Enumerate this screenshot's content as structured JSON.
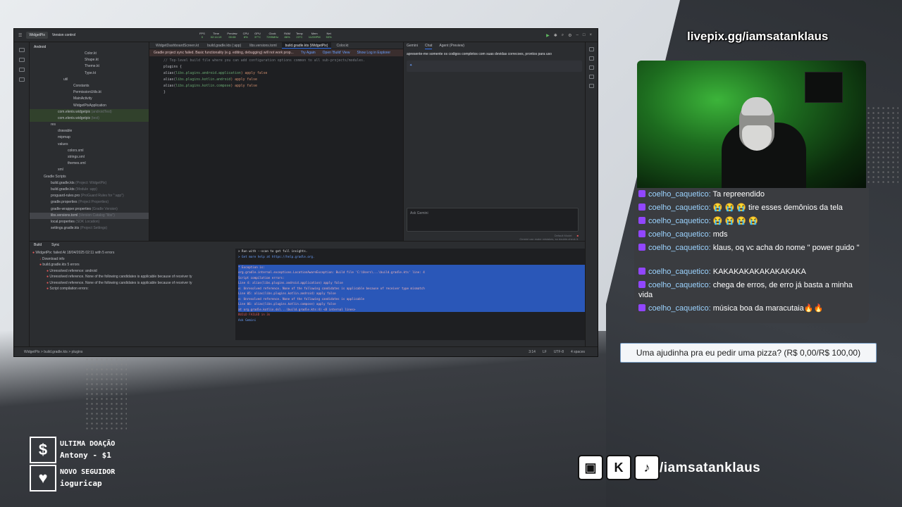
{
  "overlay": {
    "livepix": "livepix.gg/iamsatanklaus",
    "handle": "/iamsatanklaus",
    "pizza_goal": "Uma ajudinha pra eu pedir uma pizza? (R$ 0,00/R$ 100,00)",
    "last_donation_label": "ULTIMA DOAÇÃO",
    "last_donation_value": "Antony - $1",
    "new_follower_label": "NOVO SEGUIDOR",
    "new_follower_value": "ioguricap",
    "social_icons": [
      "twitch-icon",
      "kick-icon",
      "tiktok-icon"
    ]
  },
  "chat": [
    {
      "user": "coelho_caquetico",
      "text": "Ta repreendido"
    },
    {
      "user": "coelho_caquetico",
      "text": "😭 😭 😭 tire esses demônios da tela"
    },
    {
      "user": "coelho_caquetico",
      "text": "😭 😭 😭 😭"
    },
    {
      "user": "coelho_caquetico",
      "text": "mds"
    },
    {
      "user": "coelho_caquetico",
      "text": "klaus, oq vc acha do nome \" power guido \""
    },
    {
      "user": "coelho_caquetico",
      "text": "KAKAKAKAKAKAKAKAKA"
    },
    {
      "user": "coelho_caquetico",
      "text": "chega de erros, de erro já basta a minha vida"
    },
    {
      "user": "coelho_caquetico",
      "text": "música boa da maracutaia🔥🔥"
    }
  ],
  "ide": {
    "project": "WidgetPix",
    "version_control": "Version control",
    "stats": [
      {
        "label": "FPS",
        "value": "0"
      },
      {
        "label": "Time",
        "value": "02:14:19"
      },
      {
        "label": "Preview",
        "value": "00:08"
      },
      {
        "label": "CPU",
        "value": "8%"
      },
      {
        "label": "GPU",
        "value": "37°C"
      },
      {
        "label": "Clock",
        "value": "7295MHz"
      },
      {
        "label": "RAM",
        "value": "86%"
      },
      {
        "label": "Temp",
        "value": "23°C"
      },
      {
        "label": "Mem",
        "value": "11239PM"
      },
      {
        "label": "Net",
        "value": "53%"
      }
    ],
    "tree_header": "Android",
    "tree": [
      {
        "label": "Color.kt",
        "meta": "",
        "indent": 78,
        "cls": ""
      },
      {
        "label": "Shape.kt",
        "meta": "",
        "indent": 78,
        "cls": ""
      },
      {
        "label": "Theme.kt",
        "meta": "",
        "indent": 78,
        "cls": ""
      },
      {
        "label": "Type.kt",
        "meta": "",
        "indent": 78,
        "cls": ""
      },
      {
        "label": "util",
        "meta": "",
        "indent": 48,
        "cls": ""
      },
      {
        "label": "Constants",
        "meta": "",
        "indent": 62,
        "cls": ""
      },
      {
        "label": "PermissionUtils.kt",
        "meta": "",
        "indent": 62,
        "cls": ""
      },
      {
        "label": "MainActivity",
        "meta": "",
        "indent": 62,
        "cls": ""
      },
      {
        "label": "WidgetPixApplication",
        "meta": "",
        "indent": 62,
        "cls": ""
      },
      {
        "label": "com.elenis.widgetpix",
        "meta": "(androidTest)",
        "indent": 40,
        "cls": "hl"
      },
      {
        "label": "com.elenis.widgetpix",
        "meta": "(test)",
        "indent": 40,
        "cls": "hl"
      },
      {
        "label": "res",
        "meta": "",
        "indent": 30,
        "cls": ""
      },
      {
        "label": "drawable",
        "meta": "",
        "indent": 40,
        "cls": ""
      },
      {
        "label": "mipmap",
        "meta": "",
        "indent": 40,
        "cls": ""
      },
      {
        "label": "values",
        "meta": "",
        "indent": 40,
        "cls": ""
      },
      {
        "label": "colors.xml",
        "meta": "",
        "indent": 54,
        "cls": ""
      },
      {
        "label": "strings.xml",
        "meta": "",
        "indent": 54,
        "cls": ""
      },
      {
        "label": "themes.xml",
        "meta": "",
        "indent": 54,
        "cls": ""
      },
      {
        "label": "xml",
        "meta": "",
        "indent": 40,
        "cls": ""
      },
      {
        "label": "Gradle Scripts",
        "meta": "",
        "indent": 20,
        "cls": ""
      },
      {
        "label": "build.gradle.kts",
        "meta": "(Project: WidgetPix)",
        "indent": 30,
        "cls": ""
      },
      {
        "label": "build.gradle.kts",
        "meta": "(Module :app)",
        "indent": 30,
        "cls": ""
      },
      {
        "label": "proguard-rules.pro",
        "meta": "(ProGuard Rules for \":app\")",
        "indent": 30,
        "cls": ""
      },
      {
        "label": "gradle.properties",
        "meta": "(Project Properties)",
        "indent": 30,
        "cls": ""
      },
      {
        "label": "gradle-wrapper.properties",
        "meta": "(Gradle Version)",
        "indent": 30,
        "cls": ""
      },
      {
        "label": "libs.versions.toml",
        "meta": "(Version Catalog \"libs\")",
        "indent": 30,
        "cls": "sel"
      },
      {
        "label": "local.properties",
        "meta": "(SDK Location)",
        "indent": 30,
        "cls": ""
      },
      {
        "label": "settings.gradle.kts",
        "meta": "(Project Settings)",
        "indent": 30,
        "cls": ""
      }
    ],
    "tabs": [
      {
        "label": "WidgetDashboardScreen.kt",
        "active": false
      },
      {
        "label": "build.gradle.kts (:app)",
        "active": false
      },
      {
        "label": "libs.versions.toml",
        "active": false
      },
      {
        "label": "build.gradle.kts (WidgetPix)",
        "active": true
      },
      {
        "label": "Color.kt",
        "active": false
      }
    ],
    "banner": {
      "text": "Gradle project sync failed. Basic functionality (e.g. editing, debugging) will not work prop...",
      "links": [
        "Try Again",
        "Open 'Build' View",
        "Show Log in Explorer"
      ]
    },
    "code": [
      {
        "comment": "// Top-level build file where you can add configuration options common to all sub-projects/modules.",
        "pre": "",
        "str": "",
        "post": ""
      },
      {
        "comment": "",
        "pre": "plugins {",
        "str": "",
        "post": ""
      },
      {
        "comment": "",
        "pre": "    alias(",
        "str": "libs.plugins.android.application",
        "post": ") apply false"
      },
      {
        "comment": "",
        "pre": "    alias(",
        "str": "libs.plugins.kotlin.android",
        "post": ") apply false"
      },
      {
        "comment": "",
        "pre": "    alias(",
        "str": "libs.plugins.kotlin.compose",
        "post": ") apply false"
      },
      {
        "comment": "",
        "pre": "}",
        "str": "",
        "post": ""
      }
    ],
    "gemini_tabs": [
      "Gemini",
      "Chat",
      "Agent (Preview)"
    ],
    "gemini_message": "apresente-me somente os codigos completos com suas devidas correcoes, prontos para uso",
    "gemini_input_placeholder": "Ask Gemini",
    "gemini_model": "Default Model",
    "gemini_footer": "Gemini can make mistakes, so double-check it.",
    "build_tabs": [
      "Build",
      "Sync"
    ],
    "build_tree": [
      {
        "label": "WidgetPix: failed",
        "meta": "At 18/04/2025 02:11 with 5 errors",
        "indent": 4,
        "err": true
      },
      {
        "label": "Download info",
        "meta": "",
        "indent": 14,
        "err": false
      },
      {
        "label": "build.gradle.kts",
        "meta": "5 errors",
        "indent": 14,
        "err": true
      },
      {
        "label": "Unresolved reference: android",
        "meta": "",
        "indent": 24,
        "err": true
      },
      {
        "label": "Unresolved reference. None of the following candidates is applicable because of receiver ty",
        "meta": "",
        "indent": 24,
        "err": true
      },
      {
        "label": "Unresolved reference. None of the following candidates is applicable because of receiver ty",
        "meta": "",
        "indent": 24,
        "err": true
      },
      {
        "label": "Script compilation errors:",
        "meta": "",
        "indent": 24,
        "err": true
      }
    ],
    "build_output": [
      {
        "text": "> Run with --scan to get full insights.",
        "cls": ""
      },
      {
        "text": "> Get more help at https://help.gradle.org.",
        "cls": "lnk"
      },
      {
        "text": "",
        "cls": ""
      },
      {
        "text": "* Exception is:",
        "cls": "sel"
      },
      {
        "text": "org.gradle.internal.exceptions.LocationAwareException: Build file 'C:\\Users\\...\\build.gradle.kts' line: 4",
        "cls": "sel"
      },
      {
        "text": "Script compilation errors:",
        "cls": "sel"
      },
      {
        "text": "  Line 4:     alias(libs.plugins.android.application) apply false",
        "cls": "sel"
      },
      {
        "text": "  e: Unresolved reference. None of the following candidates is applicable because of receiver type mismatch",
        "cls": "sel"
      },
      {
        "text": "  Line 05:     alias(libs.plugins.kotlin.android) apply false",
        "cls": "sel"
      },
      {
        "text": "  e: Unresolved reference. None of the following candidates is applicable",
        "cls": "sel"
      },
      {
        "text": "  Line 06:     alias(libs.plugins.kotlin.compose) apply false",
        "cls": "sel"
      },
      {
        "text": "    at org.gradle.kotlin.dsl...(build.gradle.kts:4) <8 internal lines>",
        "cls": "sel"
      },
      {
        "text": "BUILD FAILED in 3s",
        "cls": "red"
      },
      {
        "text": "Ask Gemini",
        "cls": "lnk"
      }
    ],
    "status_path": "WidgetPix > build.gradle.kts > plugins",
    "status_right": [
      "3:14",
      "LF",
      "UTF-8",
      "4 spaces"
    ]
  }
}
